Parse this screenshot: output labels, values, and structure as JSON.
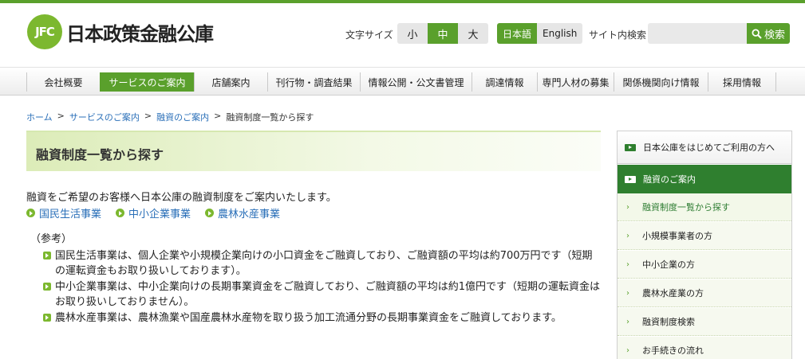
{
  "brand": {
    "mark": "JFC",
    "name": "日本政策金融公庫"
  },
  "header": {
    "font_size_label": "文字サイズ",
    "font_sizes": [
      "小",
      "中",
      "大"
    ],
    "font_size_active": "中",
    "languages": [
      "日本語",
      "English"
    ],
    "language_active": "日本語",
    "site_search_label": "サイト内検索",
    "search_placeholder": "",
    "search_button": "検索"
  },
  "nav": {
    "items": [
      "会社概要",
      "サービスのご案内",
      "店舗案内",
      "刊行物・調査結果",
      "情報公開・公文書管理",
      "調達情報",
      "専門人材の募集",
      "関係機関向け情報",
      "採用情報"
    ],
    "active": "サービスのご案内"
  },
  "breadcrumb": {
    "items": [
      "ホーム",
      "サービスのご案内",
      "融資のご案内",
      "融資制度一覧から探す"
    ],
    "separator": ">"
  },
  "main": {
    "title": "融資制度一覧から探す",
    "lead": "融資をご希望のお客様へ日本公庫の融資制度をご案内いたします。",
    "links": [
      "国民生活事業",
      "中小企業事業",
      "農林水産事業"
    ],
    "ref_label": "（参考）",
    "ref_items": [
      "国民生活事業は、個人企業や小規模企業向けの小口資金をご融資しており、ご融資額の平均は約700万円です（短期の運転資金もお取り扱いしております）。",
      "中小企業事業は、中小企業向けの長期事業資金をご融資しており、ご融資額の平均は約1億円です（短期の運転資金はお取り扱いしておりません）。",
      "農林水産事業は、農林漁業や国産農林水産物を取り扱う加工流通分野の長期事業資金をご融資しております。"
    ]
  },
  "sidebar": {
    "top": "日本公庫をはじめてご利用の方へ",
    "section": "融資のご案内",
    "sub_items": [
      "融資制度一覧から探す",
      "小規模事業者の方",
      "中小企業の方",
      "農林水産業の方",
      "融資制度検索",
      "お手続きの流れ"
    ],
    "current": "融資制度一覧から探す"
  },
  "colors": {
    "accent": "#5aa02c",
    "dark_green": "#2f7f2f",
    "link": "#2a6fb8"
  }
}
